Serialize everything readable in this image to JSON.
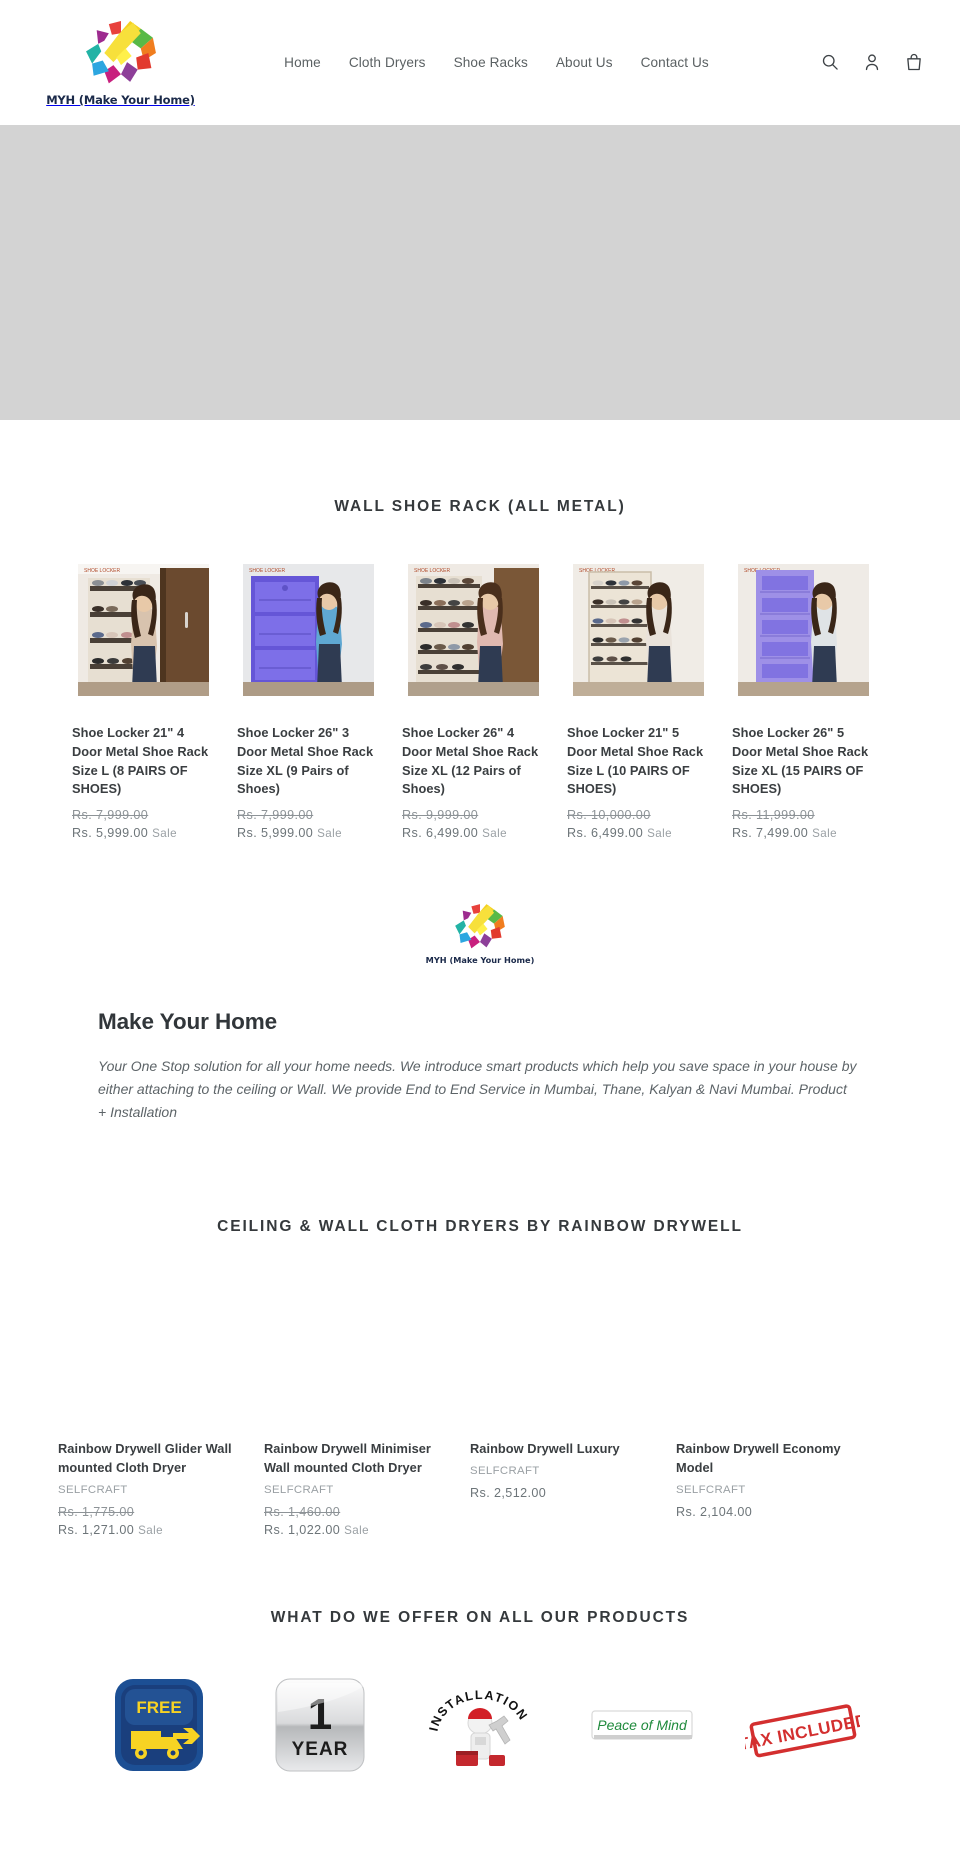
{
  "header": {
    "logo_text": "MYH (Make Your Home)",
    "logo_icon": "rainbow-burst-logo",
    "nav": [
      {
        "label": "Home"
      },
      {
        "label": "Cloth Dryers"
      },
      {
        "label": "Shoe Racks"
      },
      {
        "label": "About Us"
      },
      {
        "label": "Contact Us"
      }
    ],
    "icons": [
      {
        "name": "search-icon",
        "label": "Search"
      },
      {
        "name": "account-icon",
        "label": "Log in"
      },
      {
        "name": "cart-icon",
        "label": "Cart"
      }
    ]
  },
  "hero": {
    "background_color": "#d3d3d3"
  },
  "shoe_rack_section": {
    "title": "WALL SHOE RACK (ALL METAL)",
    "products": [
      {
        "title": "Shoe Locker 21\" 4 Door Metal Shoe Rack Size L (8 PAIRS OF SHOES)",
        "price_old": "Rs. 7,999.00",
        "price_new": "Rs. 5,999.00",
        "sale_label": "Sale",
        "image_alt": "Woman standing beside open wooden shoe locker with shoes"
      },
      {
        "title": "Shoe Locker 26\" 3 Door Metal Shoe Rack Size XL (9 Pairs of Shoes)",
        "price_old": "Rs. 7,999.00",
        "price_new": "Rs. 5,999.00",
        "sale_label": "Sale",
        "image_alt": "Woman standing beside closed blue metal shoe locker"
      },
      {
        "title": "Shoe Locker 26\" 4 Door Metal Shoe Rack Size XL (12 Pairs of Shoes)",
        "price_old": "Rs. 9,999.00",
        "price_new": "Rs. 6,499.00",
        "sale_label": "Sale",
        "image_alt": "Woman standing beside open shoe locker filled with shoes"
      },
      {
        "title": "Shoe Locker 21\" 5 Door Metal Shoe Rack Size L (10 PAIRS OF SHOES)",
        "price_old": "Rs. 10,000.00",
        "price_new": "Rs. 6,499.00",
        "sale_label": "Sale",
        "image_alt": "Woman standing beside tall open five-door shoe locker"
      },
      {
        "title": "Shoe Locker 26\" 5 Door Metal Shoe Rack Size XL (15 PAIRS OF SHOES)",
        "price_old": "Rs. 11,999.00",
        "price_new": "Rs. 7,499.00",
        "sale_label": "Sale",
        "image_alt": "Woman standing beside tall closed purple shoe locker"
      }
    ]
  },
  "brand": {
    "logo_text": "MYH (Make Your Home)",
    "heading": "Make Your Home",
    "description": "Your One Stop solution for all your home needs. We introduce smart products which help you save space in your house by either attaching to the ceiling or Wall. We provide End to End Service in Mumbai, Thane, Kalyan & Navi Mumbai. Product + Installation"
  },
  "dryer_section": {
    "title": "CEILING & WALL CLOTH DRYERS BY RAINBOW DRYWELL",
    "products": [
      {
        "title": "Rainbow Drywell Glider Wall mounted Cloth Dryer",
        "vendor": "SELFCRAFT",
        "price_old": "Rs. 1,775.00",
        "price_new": "Rs. 1,271.00",
        "sale_label": "Sale"
      },
      {
        "title": "Rainbow Drywell Minimiser Wall mounted Cloth Dryer",
        "vendor": "SELFCRAFT",
        "price_old": "Rs. 1,460.00",
        "price_new": "Rs. 1,022.00",
        "sale_label": "Sale"
      },
      {
        "title": "Rainbow Drywell Luxury",
        "vendor": "SELFCRAFT",
        "price_old": "",
        "price_new": "Rs. 2,512.00",
        "sale_label": ""
      },
      {
        "title": "Rainbow Drywell Economy Model",
        "vendor": "SELFCRAFT",
        "price_old": "",
        "price_new": "Rs. 2,104.00",
        "sale_label": ""
      }
    ]
  },
  "offers_section": {
    "title": "WHAT DO WE OFFER ON ALL OUR PRODUCTS",
    "badges": [
      {
        "name": "free-delivery-badge",
        "line1": "FREE",
        "line2": "",
        "accent": "#1c4f94"
      },
      {
        "name": "one-year-warranty-badge",
        "line1": "1",
        "line2": "YEAR",
        "accent": "#c9ccce"
      },
      {
        "name": "installation-badge",
        "line1": "INSTALLATION",
        "line2": "",
        "accent": "#d21f26"
      },
      {
        "name": "peace-of-mind-badge",
        "line1": "Peace of Mind",
        "line2": "",
        "accent": "#1f8a3c"
      },
      {
        "name": "tax-included-badge",
        "line1": "TAX INCLUDED",
        "line2": "",
        "accent": "#d32f2f"
      }
    ]
  }
}
